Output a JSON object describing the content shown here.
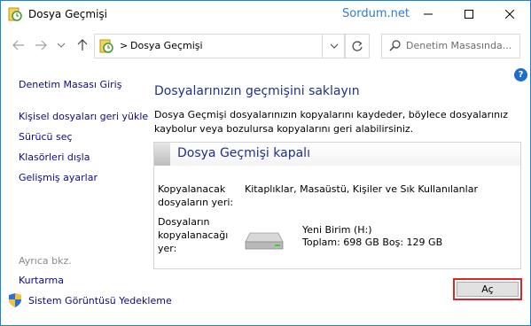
{
  "window": {
    "title": "Dosya Geçmişi",
    "watermark": "Sordum.net",
    "icon": "file-history-icon"
  },
  "navbar": {
    "breadcrumb_sep": ">",
    "breadcrumb": "Dosya Geçmişi",
    "search_placeholder": "Denetim Masasında..."
  },
  "help_label": "?",
  "sidebar": {
    "items": [
      {
        "label": "Denetim Masası Giriş"
      },
      {
        "label": "Kişisel dosyaları geri yükle"
      },
      {
        "label": "Sürücü seç"
      },
      {
        "label": "Klasörleri dışla"
      },
      {
        "label": "Gelişmiş ayarlar"
      }
    ],
    "see_also": "Ayrıca bkz.",
    "see_also_items": [
      {
        "label": "Kurtarma"
      },
      {
        "label": "Sistem Görüntüsü Yedekleme"
      }
    ]
  },
  "main": {
    "heading": "Dosyalarınızın geçmişini saklayın",
    "description": "Dosya Geçmişi dosyalarınızın kopyalarını kaydeder, böylece dosyalarınız kaybolur veya bozulursa kopyalarını geri alabilirsiniz.",
    "panel": {
      "title": "Dosya Geçmişi kapalı",
      "copy_from_label_1": "Kopyalanacak",
      "copy_from_label_2": "dosyaların yeri:",
      "copy_from_value": "Kitaplıklar, Masaüstü, Kişiler ve Sık Kullanılanlar",
      "copy_to_label_1": "Dosyaların",
      "copy_to_label_2": "kopyalanacağı",
      "copy_to_label_3": "yer:",
      "drive_name": "Yeni Birim (H:)",
      "drive_space": "Toplam: 698 GB Boş: 129 GB"
    },
    "open_button": "Aç"
  }
}
